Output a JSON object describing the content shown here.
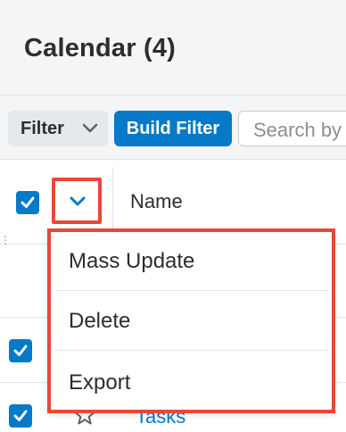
{
  "header": {
    "title": "Calendar (4)"
  },
  "filterbar": {
    "filter_label": "Filter",
    "build_filter_label": "Build Filter",
    "search_placeholder": "Search by"
  },
  "list": {
    "name_column": "Name",
    "rows": [
      {
        "checked": true,
        "name": ""
      },
      {
        "checked": true,
        "name": "Tasks"
      }
    ]
  },
  "actions_menu": {
    "items": [
      {
        "label": "Mass Update"
      },
      {
        "label": "Delete"
      },
      {
        "label": "Export"
      }
    ]
  },
  "colors": {
    "accent": "#0679c8",
    "highlight": "#e8473b"
  },
  "icons": [
    "chevron-down-icon",
    "checkmark-icon",
    "star-icon"
  ]
}
